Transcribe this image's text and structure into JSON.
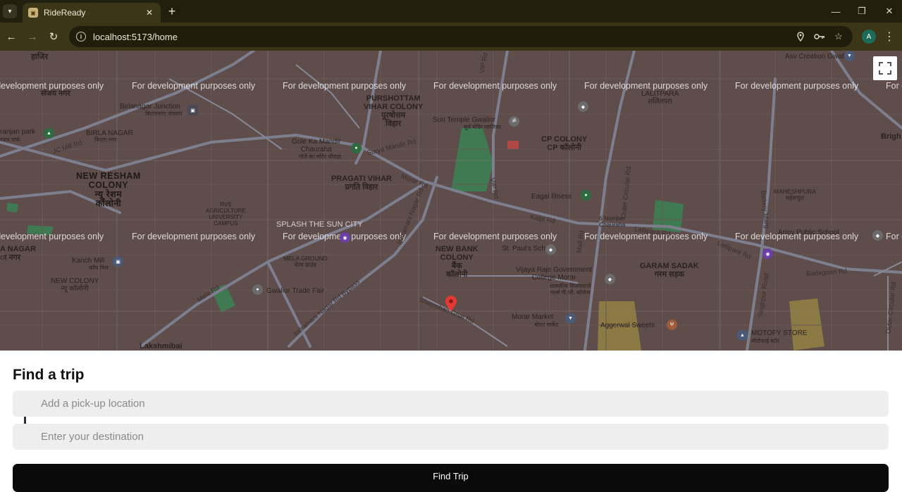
{
  "browser": {
    "tab_title": "RideReady",
    "url": "localhost:5173/home",
    "profile_initial": "A"
  },
  "map": {
    "watermark": "For development purposes only",
    "labels": {
      "hazir": "हाजिर",
      "sanjay_nagar": "संजय नगर",
      "birlanagar_junction": "Birlanagar Junction",
      "birlanagar_junction_hi": "बिरलानगर जंक्शन",
      "ranjan_park": "ranjan park",
      "ranjan_park_hi": "रंजन पार्क",
      "birla_nagar": "BIRLA NAGAR",
      "birla_nagar_hi": "बिरला नगर",
      "jc_mill_rd": "JC Mill Rd",
      "new_resham": "NEW RESHAM\nCOLONY\nन्यू रेशम\nकॉलोनी",
      "a_nagar": "A NAGAR\nा नगर",
      "kanch_mill": "Kanch Mill",
      "kanch_mill_hi": "काँच मिल",
      "new_colony": "NEW COLONY\nन्यू कॉलोनी",
      "lakshmibai": "Lakshmibai",
      "rvs": "RVS\nAGRICULTURE\nUNIVERSITY\nCAMPUS",
      "purshottam": "PURSHOTTAM\nVIHAR COLONY\nपुरषोत्तम\nविहार",
      "gole_ka_mandir": "Gole Ka Mandir\nChauraha",
      "gole_ka_mandir_hi": "गोले का मंदिर चौराहा",
      "surya_mandir_rd": "Surya Mandir Rd",
      "pragati_vihar": "PRAGATI VIHAR\nप्रगति विहार",
      "splash": "SPLASH THE SUN CITY",
      "mela_ground": "MELA GROUND\nमेला ग्राउंड",
      "gwalior_trade_fair": "Gwalior Trade Fair",
      "mela_rd": "Mela Rd",
      "indramani_bypass": "Indramani Nagar Rd Bypass",
      "indramani_rd": "Indramani Nagar Rd",
      "morar_rd": "Morar Rd",
      "vip_rd": "VIP Rd",
      "sun_temple": "Sun Temple Gwalior",
      "sun_temple_hi": "सूर्य मंदिर ग्वालियर",
      "cp_colony": "CP COLONY\nCP कॉलोनी",
      "eagal_fitness": "Eagal fitness",
      "kalpi_rd": "Kalpi Rd",
      "six_number": "6 Number\nChauraha",
      "new_bank_colony": "NEW BANK\nCOLONY\nबैंक\nकॉलोनी",
      "st_pauls": "St. Paul's School",
      "vijaya_raje": "Vijaya Raje Government\nCollege Morar",
      "vijaya_raje_hi": "शासकीय विजयाराजे\nगर्ल्स पी.जी. कॉलेज",
      "morar_market": "Morar Market",
      "morar_market_hi": "मोरार मार्केट",
      "shamshan_ghat_rd": "Shamshan Ghat Rd",
      "garam_sadak": "GARAM SADAK\nगरम सड़क",
      "aggerwal_sweets": "Aggerwal Sweets",
      "lalitpara": "LALITPARA\nललितपरा",
      "lalitpara_rd": "Laltipara Rd",
      "maheshpura": "MAHESHPURA\nमहेशपुरा",
      "army_public_school": "Army Public School",
      "badagoan_rd": "Badagoan Rd",
      "asv_cre": "Asv Creation Gwalior",
      "motofy": "MOTOFY STORE",
      "motofy_hi": "मोटोफाई स्टोर",
      "singhpur_rd": "Singhpur Road",
      "outer_circular_rd": "Outer Circular Rd",
      "mall_rd": "Mall Rd",
      "battery_marg": "Battery Marg",
      "bright": "Brigh"
    }
  },
  "form": {
    "title": "Find a trip",
    "pickup_placeholder": "Add a pick-up location",
    "destination_placeholder": "Enter your destination",
    "submit_label": "Find Trip"
  },
  "colors": {
    "map_base": "#5e4d4b",
    "accent_button": "#0a0a0a",
    "browser_frame": "#3b3617",
    "pin": "#e53935"
  }
}
